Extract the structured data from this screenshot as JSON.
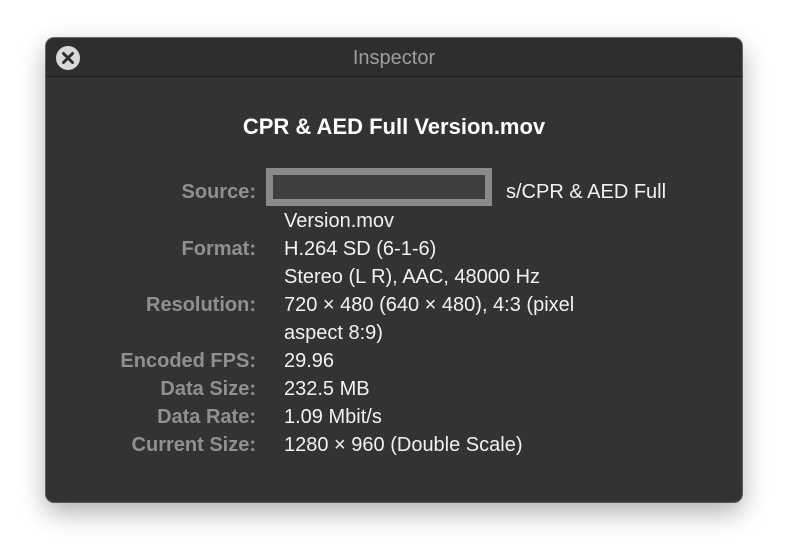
{
  "window": {
    "title": "Inspector"
  },
  "file": {
    "name": "CPR & AED Full Version.mov"
  },
  "info": {
    "source_label": "Source:",
    "source_value_line1": "s/CPR & AED Full",
    "source_value_line2": "Version.mov",
    "format_label": "Format:",
    "format_value_line1": "H.264 SD (6-1-6)",
    "format_value_line2": "Stereo (L R), AAC, 48000 Hz",
    "resolution_label": "Resolution:",
    "resolution_value_line1": "720 × 480 (640 × 480), 4:3 (pixel",
    "resolution_value_line2": "aspect 8:9)",
    "fps_label": "Encoded FPS:",
    "fps_value": "29.96",
    "datasize_label": "Data Size:",
    "datasize_value": "232.5 MB",
    "datarate_label": "Data Rate:",
    "datarate_value": "1.09 Mbit/s",
    "currentsize_label": "Current Size:",
    "currentsize_value": "1280 × 960 (Double Scale)"
  },
  "icons": {
    "close": "close-icon"
  }
}
